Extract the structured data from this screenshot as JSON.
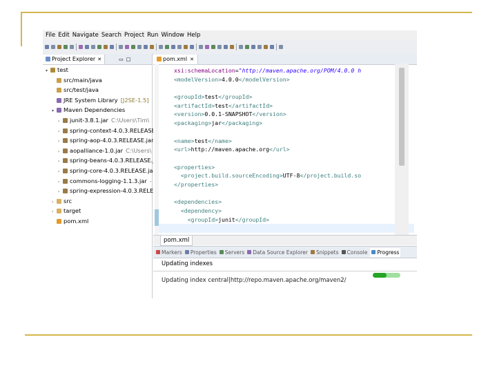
{
  "menu": [
    "File",
    "Edit",
    "Navigate",
    "Search",
    "Project",
    "Run",
    "Window",
    "Help"
  ],
  "explorer": {
    "tab_label": "Project Explorer",
    "tab_icon": "project-explorer-icon",
    "tree": [
      {
        "label": "test",
        "suffix": "",
        "indent": 0,
        "arrow": "▾",
        "icon": "project-icon"
      },
      {
        "label": "src/main/java",
        "suffix": "",
        "indent": 1,
        "arrow": "",
        "icon": "source-folder-icon"
      },
      {
        "label": "src/test/java",
        "suffix": "",
        "indent": 1,
        "arrow": "",
        "icon": "source-folder-icon"
      },
      {
        "label": "JRE System Library",
        "suffix": "[J2SE-1.5]",
        "indent": 1,
        "arrow": "",
        "icon": "library-icon"
      },
      {
        "label": "Maven Dependencies",
        "suffix": "",
        "indent": 1,
        "arrow": "▾",
        "icon": "library-icon"
      },
      {
        "label": "junit-3.8.1.jar",
        "suffix": "C:\\Users\\Tim\\",
        "indent": 2,
        "arrow": "›",
        "icon": "jar-icon"
      },
      {
        "label": "spring-context-4.0.3.RELEASE",
        "suffix": "",
        "indent": 2,
        "arrow": "›",
        "icon": "jar-icon"
      },
      {
        "label": "spring-aop-4.0.3.RELEASE.jar",
        "suffix": "",
        "indent": 2,
        "arrow": "›",
        "icon": "jar-icon"
      },
      {
        "label": "aopalliance-1.0.jar",
        "suffix": "C:\\Users\\",
        "indent": 2,
        "arrow": "›",
        "icon": "jar-icon"
      },
      {
        "label": "spring-beans-4.0.3.RELEASE.ja",
        "suffix": "",
        "indent": 2,
        "arrow": "›",
        "icon": "jar-icon"
      },
      {
        "label": "spring-core-4.0.3.RELEASE.jar",
        "suffix": "",
        "indent": 2,
        "arrow": "›",
        "icon": "jar-icon"
      },
      {
        "label": "commons-logging-1.1.3.jar",
        "suffix": "-",
        "indent": 2,
        "arrow": "›",
        "icon": "jar-icon"
      },
      {
        "label": "spring-expression-4.0.3.RELEA",
        "suffix": "",
        "indent": 2,
        "arrow": "›",
        "icon": "jar-icon"
      },
      {
        "label": "src",
        "suffix": "",
        "indent": 1,
        "arrow": "›",
        "icon": "folder-icon"
      },
      {
        "label": "target",
        "suffix": "",
        "indent": 1,
        "arrow": "›",
        "icon": "folder-icon"
      },
      {
        "label": "pom.xml",
        "suffix": "",
        "indent": 1,
        "arrow": "",
        "icon": "xml-file-icon"
      }
    ]
  },
  "editor": {
    "tab_label": "pom.xml",
    "lines": [
      [
        [
          "attr",
          "xsi:schemaLocation"
        ],
        [
          "txt",
          "="
        ],
        [
          "str",
          "\"http://maven.apache.org/POM/4.0.0 h"
        ]
      ],
      [
        [
          "tag",
          "<modelVersion>"
        ],
        [
          "txt",
          "4.0.0"
        ],
        [
          "tag",
          "</modelVersion>"
        ]
      ],
      [
        [
          "txt",
          ""
        ]
      ],
      [
        [
          "tag",
          "<groupId>"
        ],
        [
          "txt",
          "test"
        ],
        [
          "tag",
          "</groupId>"
        ]
      ],
      [
        [
          "tag",
          "<artifactId>"
        ],
        [
          "txt",
          "test"
        ],
        [
          "tag",
          "</artifactId>"
        ]
      ],
      [
        [
          "tag",
          "<version>"
        ],
        [
          "txt",
          "0.0.1-SNAPSHOT"
        ],
        [
          "tag",
          "</version>"
        ]
      ],
      [
        [
          "tag",
          "<packaging>"
        ],
        [
          "txt",
          "jar"
        ],
        [
          "tag",
          "</packaging>"
        ]
      ],
      [
        [
          "txt",
          ""
        ]
      ],
      [
        [
          "tag",
          "<name>"
        ],
        [
          "txt",
          "test"
        ],
        [
          "tag",
          "</name>"
        ]
      ],
      [
        [
          "tag",
          "<url>"
        ],
        [
          "txt",
          "http://maven.apache.org"
        ],
        [
          "tag",
          "</url>"
        ]
      ],
      [
        [
          "txt",
          ""
        ]
      ],
      [
        [
          "tag",
          "<properties>"
        ]
      ],
      [
        [
          "txt",
          "  "
        ],
        [
          "tag",
          "<project.build.sourceEncoding>"
        ],
        [
          "txt",
          "UTF-8"
        ],
        [
          "tag",
          "</project.build.so"
        ]
      ],
      [
        [
          "tag",
          "</properties>"
        ]
      ],
      [
        [
          "txt",
          ""
        ]
      ],
      [
        [
          "tag",
          "<dependencies>"
        ]
      ],
      [
        [
          "txt",
          "  "
        ],
        [
          "tag",
          "<dependency>"
        ]
      ],
      [
        [
          "txt",
          "    "
        ],
        [
          "tag",
          "<groupId>"
        ],
        [
          "txt",
          "junit"
        ],
        [
          "tag",
          "</groupId>"
        ]
      ]
    ],
    "bottom_tab_label": "pom.xml"
  },
  "bottom_panel": {
    "tabs": [
      {
        "label": "Markers",
        "icon": "markers-icon",
        "active": false
      },
      {
        "label": "Properties",
        "icon": "properties-icon",
        "active": false
      },
      {
        "label": "Servers",
        "icon": "servers-icon",
        "active": false
      },
      {
        "label": "Data Source Explorer",
        "icon": "data-source-icon",
        "active": false
      },
      {
        "label": "Snippets",
        "icon": "snippets-icon",
        "active": false
      },
      {
        "label": "Console",
        "icon": "console-icon",
        "active": false
      },
      {
        "label": "Progress",
        "icon": "progress-icon",
        "active": true
      }
    ],
    "task": "Updating indexes",
    "detail": "Updating index central|http://repo.maven.apache.org/maven2/",
    "progress_fraction": 0.5
  },
  "colors": {
    "slide_accent": "#d4b64a",
    "progress_green": "#25a525",
    "xml_tag": "#3f7f7f",
    "xml_attr": "#7f007f",
    "xml_string": "#2a00ff"
  }
}
